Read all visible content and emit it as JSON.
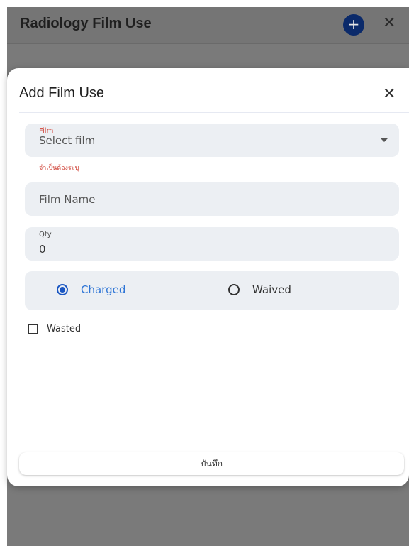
{
  "background": {
    "title": "Radiology Film Use",
    "add_icon": "plus-icon",
    "close_icon": "close-icon"
  },
  "dialog": {
    "title": "Add Film Use",
    "close_icon": "close-icon",
    "film_field": {
      "label": "Film",
      "placeholder": "Select film",
      "error": "จำเป็นต้องระบุ"
    },
    "film_name_field": {
      "placeholder": "Film Name"
    },
    "qty_field": {
      "label": "Qty",
      "value": "0"
    },
    "charge_options": [
      {
        "label": "Charged",
        "selected": true
      },
      {
        "label": "Waived",
        "selected": false
      }
    ],
    "wasted_checkbox": {
      "label": "Wasted",
      "checked": false
    },
    "save_label": "บันทึก"
  },
  "colors": {
    "accent": "#1a56c2",
    "error": "#d0453a",
    "field_bg": "#eceff3"
  }
}
